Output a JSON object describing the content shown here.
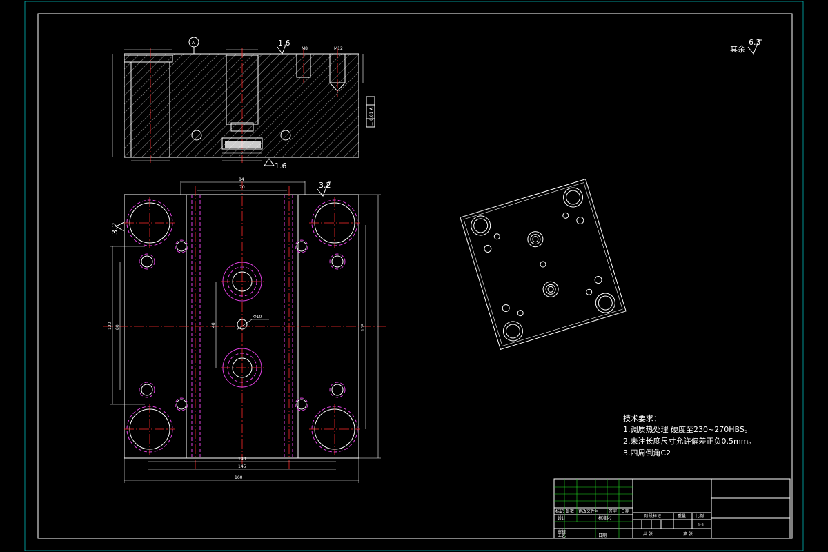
{
  "drawing": {
    "roughness_rest_label": "其余",
    "roughness_rest_value": "6.3",
    "section_view": {
      "datum_label": "A",
      "roughness_top": "1.6",
      "roughness_bottom": "1.6",
      "thread_left": "M8",
      "thread_right": "M12",
      "tolerance_frame": "⊥ 0.01 A"
    },
    "plan_view": {
      "roughness_top": "3.2",
      "roughness_left": "3.2",
      "dim_top_outer": "84",
      "dim_top_inner": "70",
      "dim_bottom_1": "140",
      "dim_bottom_2": "145",
      "dim_bottom_3": "160",
      "dim_left_outer": "120",
      "dim_left_inner": "80",
      "dim_center_vertical": "48",
      "dim_right_1": "105",
      "dim_center_hole": "Φ10"
    },
    "tech_requirements": {
      "title": "技术要求：",
      "items": [
        "1.调质热处理 硬度至230~270HBS。",
        "2.未注长度尺寸允许偏差正负0.5mm。",
        "3.四周倒角C2"
      ]
    },
    "title_block": {
      "row_labels": [
        "标记",
        "处数",
        "更改文件号",
        "签字",
        "日期"
      ],
      "designer": "设计",
      "standardize": "标准化",
      "review": "审核",
      "process": "工艺",
      "approve": "日期",
      "stage_label": "阶段标记",
      "weight_label": "重量",
      "scale_label": "比例",
      "scale_value": "1:1",
      "sheets_total": "共 张",
      "sheet_no": "第 张"
    }
  }
}
